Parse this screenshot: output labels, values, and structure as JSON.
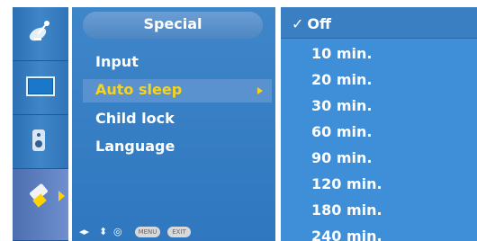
{
  "menu": {
    "title": "Special",
    "items": [
      {
        "label": "Input"
      },
      {
        "label": "Auto sleep"
      },
      {
        "label": "Child lock"
      },
      {
        "label": "Language"
      }
    ],
    "selected_index": 1
  },
  "nav": {
    "arrows_lr": "◂▸",
    "arrows_ud": "⬍",
    "ok": "◎",
    "menu_label": "MENU",
    "exit_label": "EXIT"
  },
  "submenu": {
    "selected": "Off",
    "checkmark": "✓",
    "options": [
      "10 min.",
      "20 min.",
      "30 min.",
      "60 min.",
      "90 min.",
      "120 min.",
      "180 min.",
      "240 min."
    ]
  },
  "icons": [
    "satellite-dish-icon",
    "screen-icon",
    "audio-icon",
    "tools-icon"
  ],
  "colors": {
    "panel": "#3f86c9",
    "submenu": "#3f8fd8",
    "highlight_text": "#f8d31c",
    "text": "#ffffff"
  }
}
